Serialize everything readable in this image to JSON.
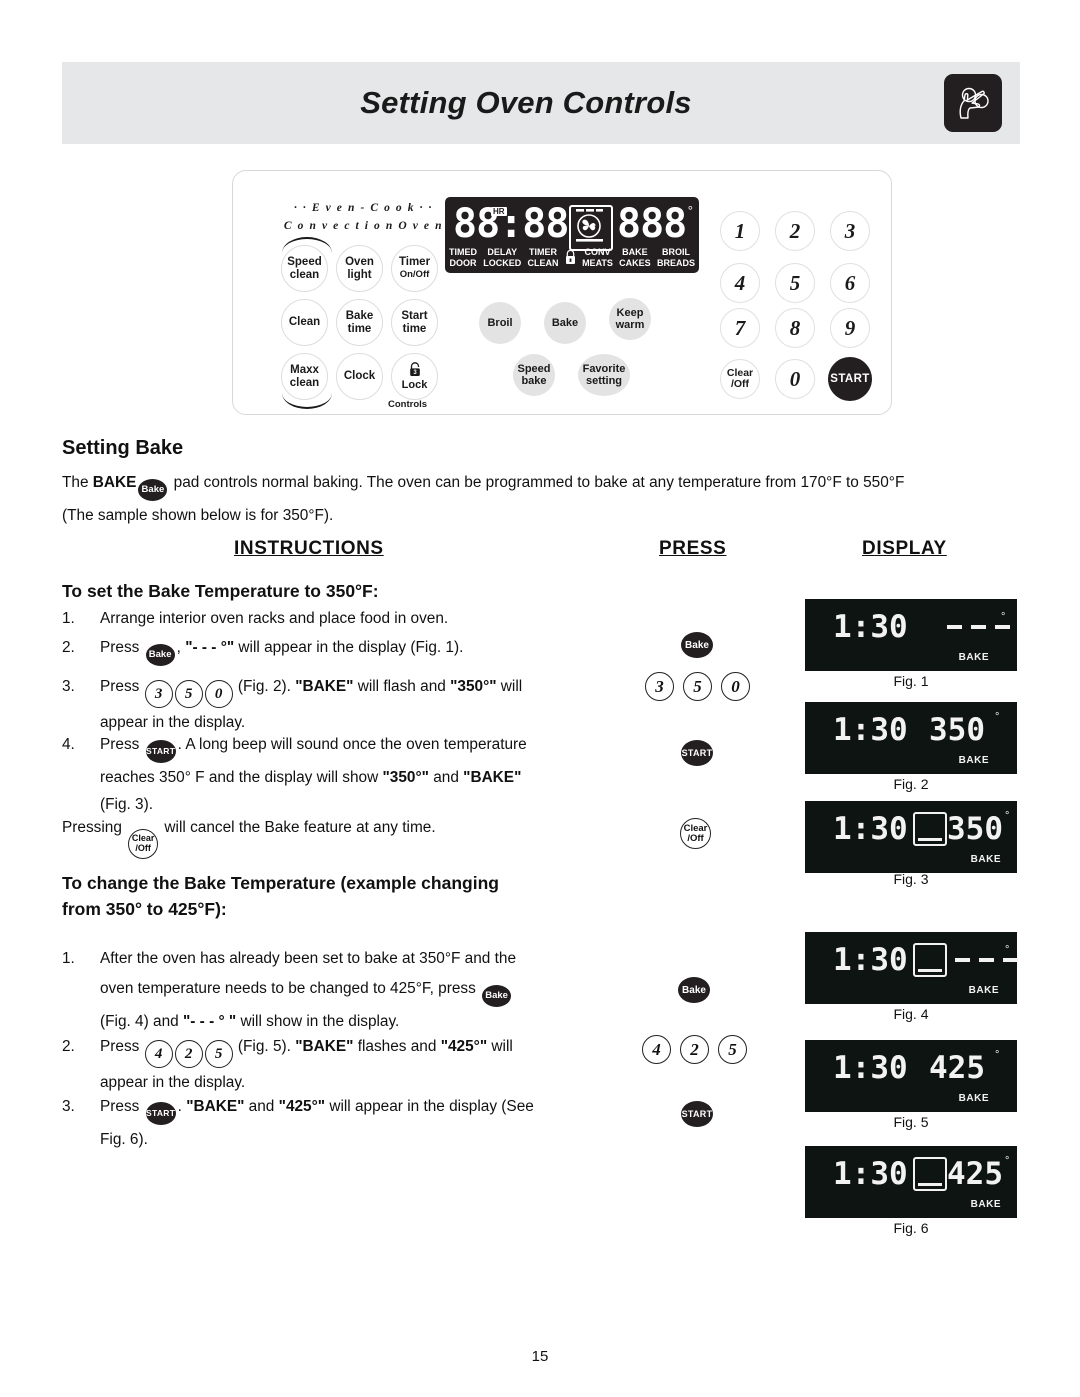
{
  "header": {
    "title": "Setting Oven Controls",
    "icon": "hand-pressing-knob-icon"
  },
  "control_panel": {
    "brand_line1": "· · E v e n - C o o k · ·",
    "brand_line2": "C o n v e c t i o n   O v e n",
    "left_buttons": [
      {
        "line1": "Speed",
        "line2": "clean"
      },
      {
        "line1": "Oven",
        "line2": "light"
      },
      {
        "line1": "Timer",
        "line2": "On/Off"
      },
      {
        "line1": "Clean",
        "line2": ""
      },
      {
        "line1": "Bake",
        "line2": "time"
      },
      {
        "line1": "Start",
        "line2": "time"
      },
      {
        "line1": "Maxx",
        "line2": "clean"
      },
      {
        "line1": "Clock",
        "line2": ""
      },
      {
        "line1": "Lock",
        "line2": ""
      }
    ],
    "lock_sublabel": "Controls",
    "lock_badge": "3",
    "gray_buttons": [
      {
        "line1": "Broil",
        "line2": ""
      },
      {
        "line1": "Bake",
        "line2": ""
      },
      {
        "line1": "Keep",
        "line2": "warm"
      },
      {
        "line1": "Speed",
        "line2": "bake"
      },
      {
        "line1": "Favorite",
        "line2": "setting"
      }
    ],
    "keypad": [
      "1",
      "2",
      "3",
      "4",
      "5",
      "6",
      "7",
      "8",
      "9",
      "0"
    ],
    "clear_line1": "Clear",
    "clear_line2": "/Off",
    "start_label": "START",
    "led": {
      "clock": "88:88",
      "hr": "HR",
      "temp": "888",
      "degree": "°",
      "labels_top": [
        "TIMED",
        "DELAY",
        "TIMER",
        "\u0000",
        "CONV",
        "BAKE",
        "BROIL"
      ],
      "labels_bottom": [
        "DOOR",
        "LOCKED",
        "CLEAN",
        "\u0000",
        "MEATS",
        "CAKES",
        "BREADS"
      ],
      "lock_icon": "padlock-icon",
      "fan_icon": "convection-fan-icon"
    }
  },
  "section": {
    "heading": "Setting Bake",
    "intro_line1_a": "The ",
    "intro_bake_word": "BAKE",
    "intro_pad": "Bake",
    "intro_line1_b": " pad controls normal baking. The oven can be programmed to bake at any temperature from 170°F to 550°F",
    "intro_line2": "(The sample shown below is for 350°F)."
  },
  "columns": {
    "instructions": "INSTRUCTIONS",
    "press": "PRESS",
    "display": "DISPLAY"
  },
  "proc1": {
    "title": "To set the Bake Temperature to 350°F:",
    "step1_num": "1.",
    "step1_text": "Arrange interior oven racks and place food in oven.",
    "step2_num": "2.",
    "step2_a": "Press ",
    "step2_pad": "Bake",
    "step2_b": ", ",
    "step2_quote": "\"- - - °\"",
    "step2_c": " will appear in the display (Fig. 1).",
    "step3_num": "3.",
    "step3_a": "Press ",
    "step3_digits": [
      "3",
      "5",
      "0"
    ],
    "step3_b": " (Fig. 2). ",
    "step3_bold1": "\"BAKE\"",
    "step3_c": " will flash and ",
    "step3_bold2": "\"350°\"",
    "step3_d": " will",
    "step3_e": "appear in the display.",
    "step4_num": "4.",
    "step4_a": "Press ",
    "step4_pad": "START",
    "step4_b": ". A long beep will sound once the oven temperature",
    "step4_c": "reaches 350° F and the display will show ",
    "step4_bold1": "\"350°\"",
    "step4_d": " and ",
    "step4_bold2": "\"BAKE\"",
    "step4_e": "(Fig. 3).",
    "note_a": "Pressing ",
    "note_pad1": "Clear",
    "note_pad2": "/Off",
    "note_b": " will cancel the Bake feature at any time."
  },
  "proc2": {
    "title_line1": "To change the Bake Temperature (example changing",
    "title_line2": "from 350° to 425°F):",
    "step1_num": "1.",
    "step1_a": "After the oven has already been set to bake at 350°F and the",
    "step1_b": "oven temperature needs to be changed to 425°F, press ",
    "step1_pad": "Bake",
    "step1_c": "(Fig. 4) and  ",
    "step1_quote": "\"- - - ° \"",
    "step1_d": " will show in the display.",
    "step2_num": "2.",
    "step2_a": "Press ",
    "step2_digits": [
      "4",
      "2",
      "5"
    ],
    "step2_b": " (Fig. 5). ",
    "step2_bold1": "\"BAKE\"",
    "step2_c": " flashes and ",
    "step2_bold2": "\"425°\"",
    "step2_d": " will",
    "step2_e": "appear in the display.",
    "step3_num": "3.",
    "step3_a": "Press ",
    "step3_pad": "START",
    "step3_b": ". ",
    "step3_bold1": "\"BAKE\"",
    "step3_c": " and ",
    "step3_bold2": "\"425°\"",
    "step3_d": " will appear in the display (See",
    "step3_e": "Fig. 6)."
  },
  "press_column": {
    "p1_bake": "Bake",
    "p1_digits": [
      "3",
      "5",
      "0"
    ],
    "p1_start": "START",
    "p1_clear_l1": "Clear",
    "p1_clear_l2": "/Off",
    "p2_bake": "Bake",
    "p2_digits": [
      "4",
      "2",
      "5"
    ],
    "p2_start": "START"
  },
  "figures": [
    {
      "caption": "Fig. 1",
      "clock": "1:30",
      "temp": "- - -",
      "temp_is_dash": true,
      "box": false,
      "bake": "BAKE",
      "degree": "°"
    },
    {
      "caption": "Fig. 2",
      "clock": "1:30",
      "temp": "350",
      "temp_is_dash": false,
      "box": false,
      "bake": "BAKE",
      "degree": "°"
    },
    {
      "caption": "Fig. 3",
      "clock": "1:30",
      "temp": "350",
      "temp_is_dash": false,
      "box": true,
      "bake": "BAKE",
      "degree": "°"
    },
    {
      "caption": "Fig. 4",
      "clock": "1:30",
      "temp": "- - -",
      "temp_is_dash": true,
      "box": true,
      "bake": "BAKE",
      "degree": "°"
    },
    {
      "caption": "Fig. 5",
      "clock": "1:30",
      "temp": "425",
      "temp_is_dash": false,
      "box": false,
      "bake": "BAKE",
      "degree": "°"
    },
    {
      "caption": "Fig. 6",
      "clock": "1:30",
      "temp": "425",
      "temp_is_dash": false,
      "box": true,
      "bake": "BAKE",
      "degree": "°"
    }
  ],
  "page_number": "15"
}
